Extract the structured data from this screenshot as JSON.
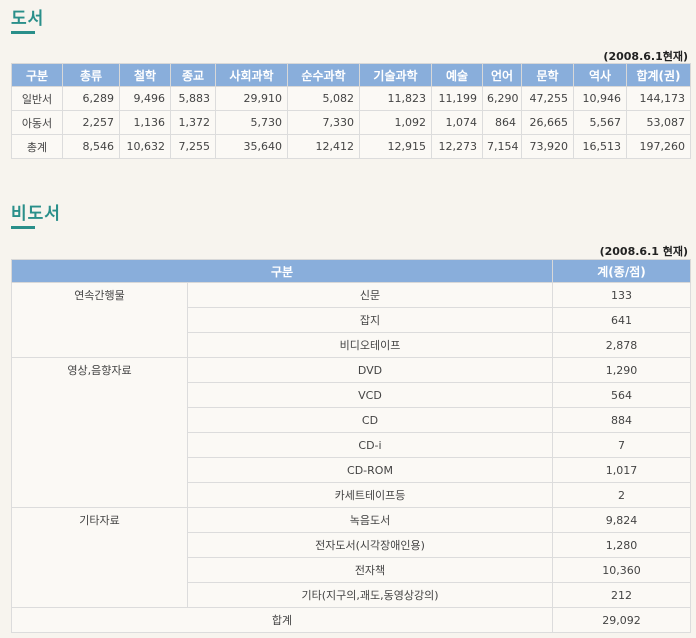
{
  "books_section": {
    "title": "도서",
    "as_of": "(2008.6.1현재)",
    "headers": [
      "구분",
      "총류",
      "철학",
      "종교",
      "사회과학",
      "순수과학",
      "기술과학",
      "예술",
      "언어",
      "문학",
      "역사",
      "합계(권)"
    ],
    "rows": [
      [
        "일반서",
        "6,289",
        "9,496",
        "5,883",
        "29,910",
        "5,082",
        "11,823",
        "11,199",
        "6,290",
        "47,255",
        "10,946",
        "144,173"
      ],
      [
        "아동서",
        "2,257",
        "1,136",
        "1,372",
        "5,730",
        "7,330",
        "1,092",
        "1,074",
        "864",
        "26,665",
        "5,567",
        "53,087"
      ],
      [
        "총계",
        "8,546",
        "10,632",
        "7,255",
        "35,640",
        "12,412",
        "12,915",
        "12,273",
        "7,154",
        "73,920",
        "16,513",
        "197,260"
      ]
    ]
  },
  "nonbooks_section": {
    "title": "비도서",
    "as_of": "(2008.6.1 현재)",
    "headers": [
      "구분",
      "계(종/점)"
    ],
    "rows": [
      {
        "category": "연속간행물",
        "item": "신문",
        "count": "133"
      },
      {
        "category": "",
        "item": "잡지",
        "count": "641"
      },
      {
        "category": "",
        "item": "비디오테이프",
        "count": "2,878"
      },
      {
        "category": "영상,음향자료",
        "item": "DVD",
        "count": "1,290"
      },
      {
        "category": "",
        "item": "VCD",
        "count": "564"
      },
      {
        "category": "",
        "item": "CD",
        "count": "884"
      },
      {
        "category": "",
        "item": "CD-i",
        "count": "7"
      },
      {
        "category": "",
        "item": "CD-ROM",
        "count": "1,017"
      },
      {
        "category": "",
        "item": "카세트테이프등",
        "count": "2"
      },
      {
        "category": "기타자료",
        "item": "녹음도서",
        "count": "9,824"
      },
      {
        "category": "",
        "item": "전자도서(시각장애인용)",
        "count": "1,280"
      },
      {
        "category": "",
        "item": "전자책",
        "count": "10,360"
      },
      {
        "category": "",
        "item": "기타(지구의,괘도,동영상강의)",
        "count": "212"
      }
    ],
    "total_label": "합계",
    "total_value": "29,092"
  }
}
